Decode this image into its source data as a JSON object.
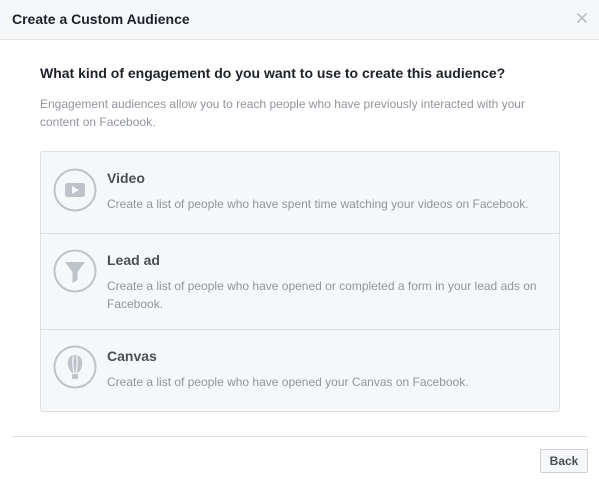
{
  "dialog": {
    "title": "Create a Custom Audience",
    "close_icon": "close-icon"
  },
  "main": {
    "question": "What kind of engagement do you want to use to create this audience?",
    "description": "Engagement audiences allow you to reach people who have previously interacted with your content on Facebook."
  },
  "options": [
    {
      "icon": "video-icon",
      "title": "Video",
      "description": "Create a list of people who have spent time watching your videos on Facebook."
    },
    {
      "icon": "funnel-icon",
      "title": "Lead ad",
      "description": "Create a list of people who have opened or completed a form in your lead ads on Facebook."
    },
    {
      "icon": "canvas-icon",
      "title": "Canvas",
      "description": "Create a list of people who have opened your Canvas on Facebook."
    }
  ],
  "footer": {
    "back_label": "Back"
  },
  "colors": {
    "header_bg": "#f6f7f9",
    "title_text": "#1d2129",
    "muted_text": "#90949c",
    "option_title": "#4b4f56",
    "border": "#dddfe2",
    "icon_gray": "#bec2c9"
  }
}
